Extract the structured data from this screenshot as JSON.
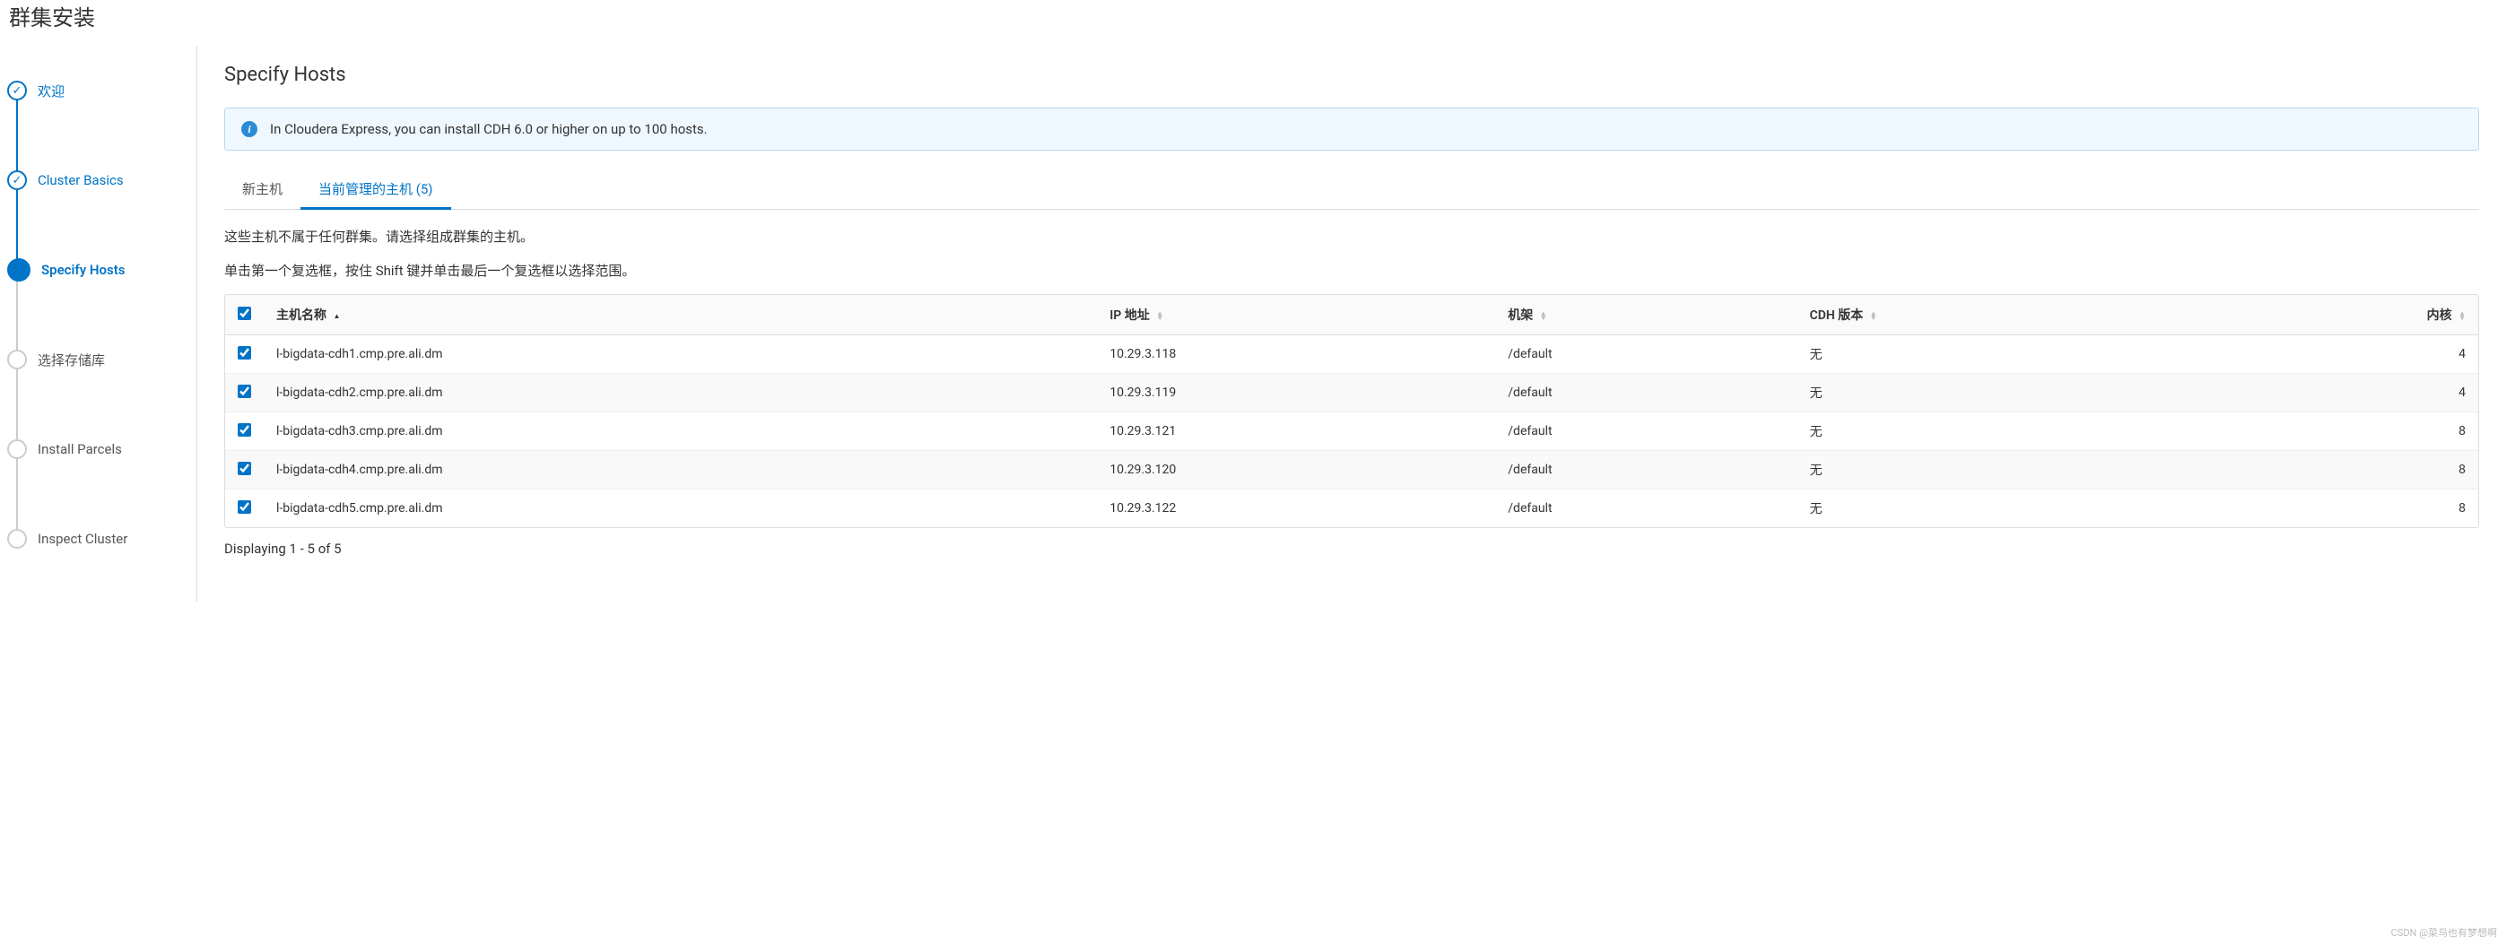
{
  "page_title": "群集安装",
  "steps": [
    {
      "label": "欢迎",
      "state": "done"
    },
    {
      "label": "Cluster Basics",
      "state": "done"
    },
    {
      "label": "Specify Hosts",
      "state": "current"
    },
    {
      "label": "选择存储库",
      "state": "pending"
    },
    {
      "label": "Install Parcels",
      "state": "pending"
    },
    {
      "label": "Inspect Cluster",
      "state": "pending"
    }
  ],
  "main": {
    "title": "Specify Hosts",
    "info_banner": "In Cloudera Express, you can install CDH 6.0 or higher on up to 100 hosts.",
    "tabs": [
      {
        "label": "新主机",
        "active": false
      },
      {
        "label": "当前管理的主机 (5)",
        "active": true
      }
    ],
    "desc1": "这些主机不属于任何群集。请选择组成群集的主机。",
    "desc2": "单击第一个复选框，按住 Shift 键并单击最后一个复选框以选择范围。",
    "columns": {
      "hostname": "主机名称",
      "ip": "IP 地址",
      "rack": "机架",
      "cdh": "CDH 版本",
      "cores": "内核"
    },
    "rows": [
      {
        "checked": true,
        "hostname": "l-bigdata-cdh1.cmp.pre.ali.dm",
        "ip": "10.29.3.118",
        "rack": "/default",
        "cdh": "无",
        "cores": "4"
      },
      {
        "checked": true,
        "hostname": "l-bigdata-cdh2.cmp.pre.ali.dm",
        "ip": "10.29.3.119",
        "rack": "/default",
        "cdh": "无",
        "cores": "4"
      },
      {
        "checked": true,
        "hostname": "l-bigdata-cdh3.cmp.pre.ali.dm",
        "ip": "10.29.3.121",
        "rack": "/default",
        "cdh": "无",
        "cores": "8"
      },
      {
        "checked": true,
        "hostname": "l-bigdata-cdh4.cmp.pre.ali.dm",
        "ip": "10.29.3.120",
        "rack": "/default",
        "cdh": "无",
        "cores": "8"
      },
      {
        "checked": true,
        "hostname": "l-bigdata-cdh5.cmp.pre.ali.dm",
        "ip": "10.29.3.122",
        "rack": "/default",
        "cdh": "无",
        "cores": "8"
      }
    ],
    "pager": "Displaying 1 - 5 of 5"
  },
  "watermark": "CSDN @菜鸟也有梦想啊"
}
